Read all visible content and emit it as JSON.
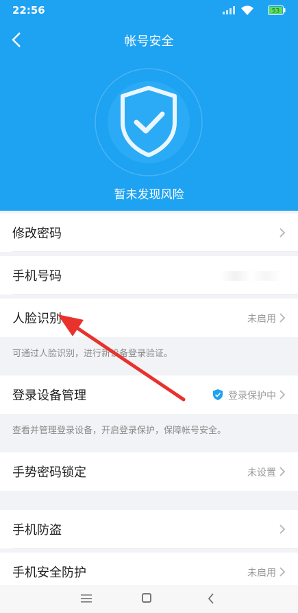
{
  "status": {
    "time": "22:56",
    "battery": "53"
  },
  "header": {
    "title": "帐号安全",
    "status_text": "暂未发现风险"
  },
  "rows": [
    {
      "label": "修改密码",
      "value": ""
    },
    {
      "label": "手机号码",
      "value": ""
    },
    {
      "label": "人脸识别",
      "value": "未启用"
    },
    {
      "label": "登录设备管理",
      "value": "登录保护中"
    },
    {
      "label": "手势密码锁定",
      "value": "未设置"
    },
    {
      "label": "手机防盗",
      "value": ""
    },
    {
      "label": "手机安全防护",
      "value": "未启用"
    }
  ],
  "notes": {
    "face": "可通过人脸识别，进行新设备登录验证。",
    "device": "查看并管理登录设备，开启登录保护，保障帐号安全。"
  },
  "colors": {
    "header_bg": "#1ea2f2",
    "arrow": "#e8322b"
  },
  "icons": [
    "back-icon",
    "shield-check-icon",
    "chevron-right-icon",
    "shield-badge-icon",
    "menu-icon",
    "home-icon",
    "nav-back-icon"
  ]
}
